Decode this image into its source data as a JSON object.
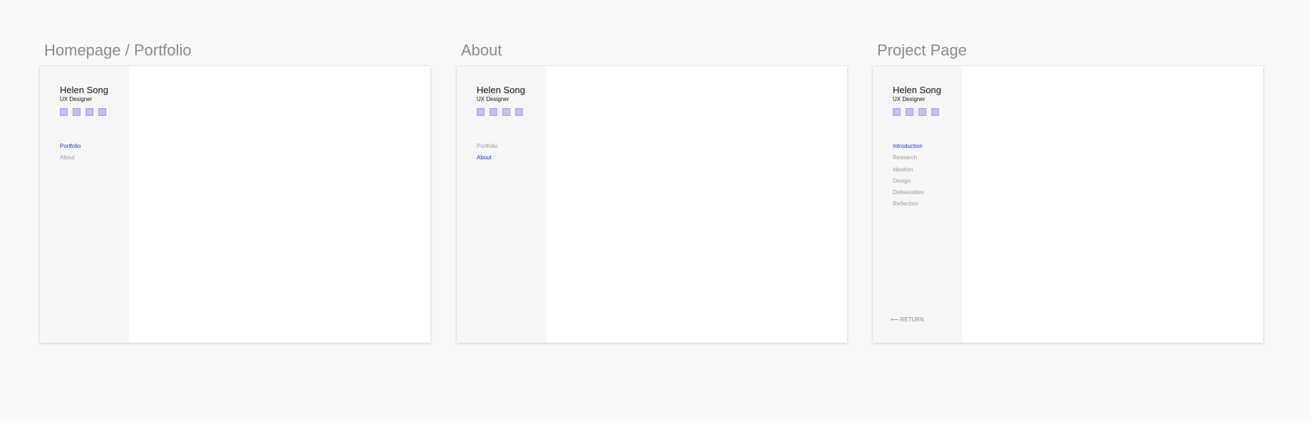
{
  "boards": [
    {
      "title": "Homepage / Portfolio",
      "sidebar": {
        "name": "Helen Song",
        "role": "UX Designer",
        "social_icons": [
          "social-icon-1",
          "social-icon-2",
          "social-icon-3",
          "social-icon-4"
        ],
        "nav": [
          {
            "label": "Portfolio",
            "active": true
          },
          {
            "label": "About",
            "active": false
          }
        ]
      }
    },
    {
      "title": "About",
      "sidebar": {
        "name": "Helen Song",
        "role": "UX Designer",
        "social_icons": [
          "social-icon-1",
          "social-icon-2",
          "social-icon-3",
          "social-icon-4"
        ],
        "nav": [
          {
            "label": "Portfolio",
            "active": false
          },
          {
            "label": "About",
            "active": true
          }
        ]
      }
    },
    {
      "title": "Project Page",
      "sidebar": {
        "name": "Helen Song",
        "role": "UX Designer",
        "social_icons": [
          "social-icon-1",
          "social-icon-2",
          "social-icon-3",
          "social-icon-4"
        ],
        "nav": [
          {
            "label": "Introduction",
            "active": true
          },
          {
            "label": "Research",
            "active": false
          },
          {
            "label": "Ideation",
            "active": false
          },
          {
            "label": "Design",
            "active": false
          },
          {
            "label": "Deliverables",
            "active": false
          },
          {
            "label": "Reflection",
            "active": false
          }
        ],
        "return_label": "RETURN"
      }
    }
  ],
  "colors": {
    "canvas_bg": "#f9f9f9",
    "sidebar_bg": "#f6f6f6",
    "active_link": "#2233dd",
    "inactive_link": "#9a9a9a",
    "social_icon_fill": "#c5bdf7",
    "board_title": "#8a8a8a"
  }
}
